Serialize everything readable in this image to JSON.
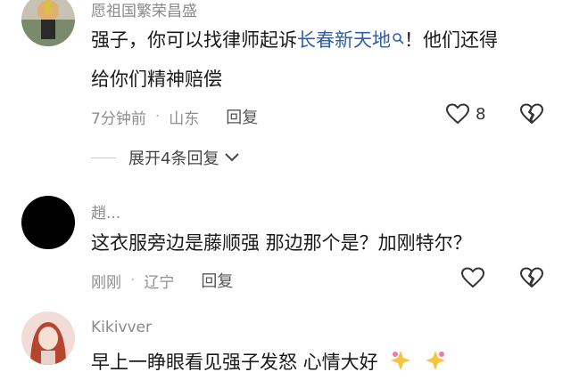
{
  "comments": [
    {
      "username": "愿祖国繁荣昌盛",
      "content_line1_prefix": "强子，你可以找律师起诉",
      "content_link": "长春新天地",
      "content_line1_suffix": "！他们还得",
      "content_line2": "给你们精神赔偿",
      "time": "7分钟前",
      "location": "山东",
      "reply_label": "回复",
      "likes": "8",
      "expand_label": "展开4条回复",
      "link_icon": "search-icon"
    },
    {
      "username": "趙...",
      "content_line1": "这衣服旁边是藤顺强 那边那个是？加刚特尔？",
      "time": "刚刚",
      "location": "辽宁",
      "reply_label": "回复"
    },
    {
      "username": "Kikivver",
      "content_line1": "早上一睁眼看见强子发怒 心情大好"
    }
  ],
  "colors": {
    "link": "#2f5fa8",
    "meta": "#8e8e8e"
  }
}
